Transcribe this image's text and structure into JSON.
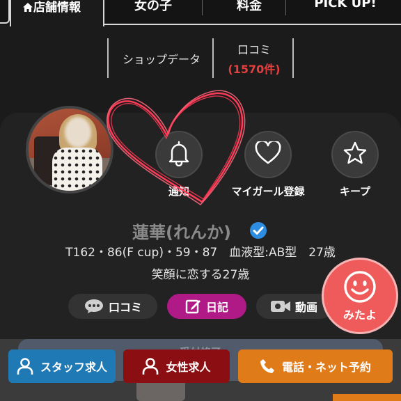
{
  "tabs": {
    "active": "店舗情報",
    "items": [
      "女の子",
      "料金",
      "PICK UP!"
    ]
  },
  "subnav": {
    "shop_data": "ショップデータ",
    "review_label": "口コミ",
    "review_count": "(1570件)"
  },
  "actions": {
    "notify": "通知",
    "my_girl": "マイガール登録",
    "keep": "キープ"
  },
  "profile": {
    "name": "蓮華(れんか)",
    "stats": "T162・86(F cup)・59・87　血液型:AB型　27歳",
    "tagline": "笑顔に恋する27歳"
  },
  "pills": {
    "review": "口コミ",
    "diary": "日記",
    "video": "動画"
  },
  "mitayo": "みたよ",
  "banner": {
    "promo": "受付終了"
  },
  "bottom_buttons": {
    "staff": "スタッフ求人",
    "female": "女性求人",
    "reserve": "電話・ネット予約"
  },
  "colors": {
    "background": "#1b1b1b",
    "review_count": "#e53e3e",
    "diary": "#b01a86",
    "mitayo": "#ef5b5b",
    "staff": "#1f79b5",
    "female": "#8b0f12",
    "reserve": "#e07b1a",
    "verified": "#2d8de0",
    "heart": "#ff3b57"
  }
}
